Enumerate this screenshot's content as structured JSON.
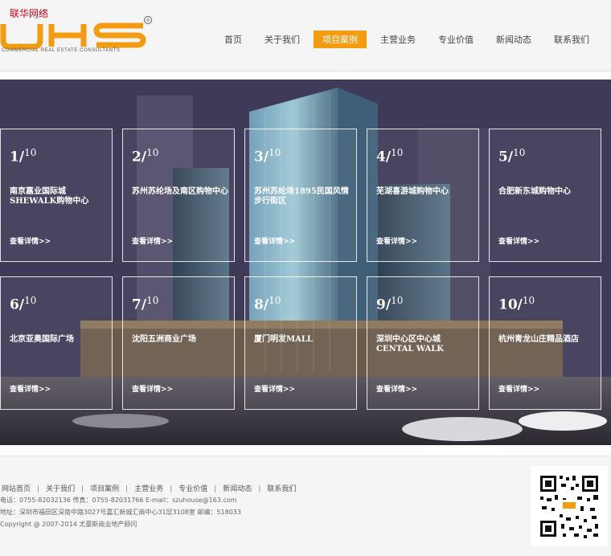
{
  "corner_text": "联华网络",
  "logo": {
    "text": "UHS",
    "subtitle": "COMMERCIAL REAL ESTATE CONSULTANTS",
    "registered": "®"
  },
  "nav": [
    {
      "label": "首页"
    },
    {
      "label": "关于我们"
    },
    {
      "label": "项目案例"
    },
    {
      "label": "主营业务"
    },
    {
      "label": "专业价值"
    },
    {
      "label": "新闻动态"
    },
    {
      "label": "联系我们"
    }
  ],
  "active_nav": "项目案例",
  "accent_color": "#f39c12",
  "projects": [
    {
      "num": "1",
      "total": "10",
      "title": "南京嘉业国际城 SHEWALK购物中心",
      "more": "查看详情>>"
    },
    {
      "num": "2",
      "total": "10",
      "title": "苏州苏纶场及南区购物中心",
      "more": "查看详情>>"
    },
    {
      "num": "3",
      "total": "10",
      "title": "苏州苏纶场1895民国风情步行街区",
      "more": "查看详情>>"
    },
    {
      "num": "4",
      "total": "10",
      "title": "芜湖喜游城购物中心",
      "more": "查看详情>>"
    },
    {
      "num": "5",
      "total": "10",
      "title": "合肥新东城购物中心",
      "more": "查看详情>>"
    },
    {
      "num": "6",
      "total": "10",
      "title": "北京亚奥国际广场",
      "more": "查看详情>>"
    },
    {
      "num": "7",
      "total": "10",
      "title": "沈阳五洲商业广场",
      "more": "查看详情>>"
    },
    {
      "num": "8",
      "total": "10",
      "title": "厦门明发MALL",
      "more": "查看详情>>"
    },
    {
      "num": "9",
      "total": "10",
      "title": "深圳中心区中心城 CENTAL WALK",
      "more": "查看详情>>"
    },
    {
      "num": "10",
      "total": "10",
      "title": "杭州青龙山庄精品酒店",
      "more": "查看详情>>"
    }
  ],
  "footer": {
    "links": [
      "网站首页",
      "关于我们",
      "项目案例",
      "主营业务",
      "专业价值",
      "新闻动态",
      "联系我们"
    ],
    "contact": "电话：0755-82032136 传真：0755-82031766 E-mail：szuhouse@163.com",
    "address": "地址：深圳市福田区深南中路3027号嘉汇新城汇商中心31层3108室 邮编：518033",
    "copyright": "Copyright @ 2007-2014 尤豪斯商业地产顾问"
  }
}
